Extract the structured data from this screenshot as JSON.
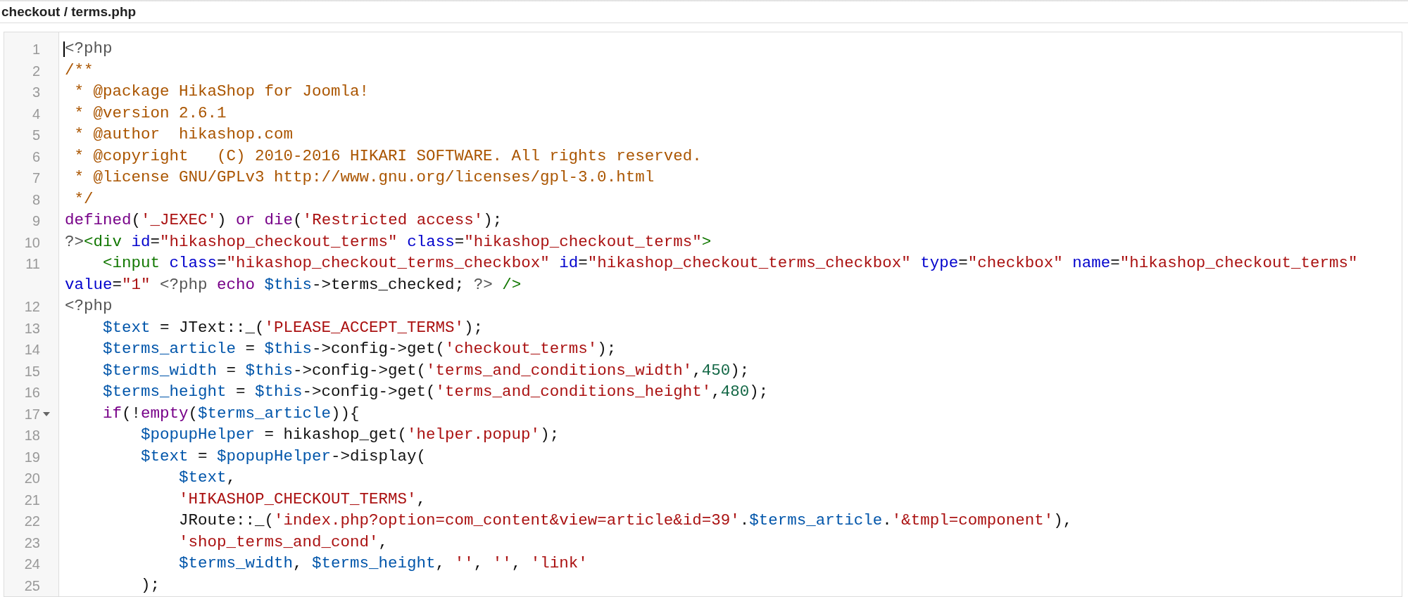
{
  "header": {
    "title": "checkout / terms.php"
  },
  "editor": {
    "lines": [
      {
        "number": "1",
        "tokens": [
          {
            "kind": "meta",
            "text": "<?php"
          }
        ]
      },
      {
        "number": "2",
        "tokens": [
          {
            "kind": "comment",
            "text": "/**"
          }
        ]
      },
      {
        "number": "3",
        "tokens": [
          {
            "kind": "comment",
            "text": " * @package HikaShop for Joomla!"
          }
        ]
      },
      {
        "number": "4",
        "tokens": [
          {
            "kind": "comment",
            "text": " * @version 2.6.1"
          }
        ]
      },
      {
        "number": "5",
        "tokens": [
          {
            "kind": "comment",
            "text": " * @author  hikashop.com"
          }
        ]
      },
      {
        "number": "6",
        "tokens": [
          {
            "kind": "comment",
            "text": " * @copyright   (C) 2010-2016 HIKARI SOFTWARE. All rights reserved."
          }
        ]
      },
      {
        "number": "7",
        "tokens": [
          {
            "kind": "comment",
            "text": " * @license GNU/GPLv3 http://www.gnu.org/licenses/gpl-3.0.html"
          }
        ]
      },
      {
        "number": "8",
        "tokens": [
          {
            "kind": "comment",
            "text": " */"
          }
        ]
      },
      {
        "number": "9",
        "tokens": [
          {
            "kind": "keyword",
            "text": "defined"
          },
          {
            "kind": "plain",
            "text": "("
          },
          {
            "kind": "string",
            "text": "'_JEXEC'"
          },
          {
            "kind": "plain",
            "text": ") "
          },
          {
            "kind": "keyword",
            "text": "or"
          },
          {
            "kind": "keyword",
            "text": " die"
          },
          {
            "kind": "plain",
            "text": "("
          },
          {
            "kind": "string",
            "text": "'Restricted access'"
          },
          {
            "kind": "plain",
            "text": ");"
          }
        ]
      },
      {
        "number": "10",
        "tokens": [
          {
            "kind": "meta",
            "text": "?>"
          },
          {
            "kind": "tag",
            "text": "<div"
          },
          {
            "kind": "attr",
            "text": " id"
          },
          {
            "kind": "plain",
            "text": "="
          },
          {
            "kind": "string",
            "text": "\"hikashop_checkout_terms\""
          },
          {
            "kind": "attr",
            "text": " class"
          },
          {
            "kind": "plain",
            "text": "="
          },
          {
            "kind": "string",
            "text": "\"hikashop_checkout_terms\""
          },
          {
            "kind": "tag",
            "text": ">"
          }
        ]
      },
      {
        "number": "11",
        "tokens": [
          {
            "kind": "tag",
            "text": "    <input"
          },
          {
            "kind": "attr",
            "text": " class"
          },
          {
            "kind": "plain",
            "text": "="
          },
          {
            "kind": "string",
            "text": "\"hikashop_checkout_terms_checkbox\""
          },
          {
            "kind": "attr",
            "text": " id"
          },
          {
            "kind": "plain",
            "text": "="
          },
          {
            "kind": "string",
            "text": "\"hikashop_checkout_terms_checkbox\""
          },
          {
            "kind": "attr",
            "text": " type"
          },
          {
            "kind": "plain",
            "text": "="
          },
          {
            "kind": "string",
            "text": "\"checkbox\""
          },
          {
            "kind": "attr",
            "text": " name"
          },
          {
            "kind": "plain",
            "text": "="
          },
          {
            "kind": "string",
            "text": "\"hikashop_checkout_terms\""
          }
        ],
        "continuation": [
          {
            "kind": "attr",
            "text": "value"
          },
          {
            "kind": "plain",
            "text": "="
          },
          {
            "kind": "string",
            "text": "\"1\""
          },
          {
            "kind": "meta",
            "text": " <?php"
          },
          {
            "kind": "keyword",
            "text": " echo"
          },
          {
            "kind": "variable",
            "text": " $this"
          },
          {
            "kind": "plain",
            "text": "->terms_checked; "
          },
          {
            "kind": "meta",
            "text": "?>"
          },
          {
            "kind": "tag",
            "text": " />"
          }
        ]
      },
      {
        "number": "12",
        "tokens": [
          {
            "kind": "meta",
            "text": "<?php"
          }
        ]
      },
      {
        "number": "13",
        "tokens": [
          {
            "kind": "variable",
            "text": "    $text"
          },
          {
            "kind": "plain",
            "text": " = JText::_("
          },
          {
            "kind": "string",
            "text": "'PLEASE_ACCEPT_TERMS'"
          },
          {
            "kind": "plain",
            "text": ");"
          }
        ]
      },
      {
        "number": "14",
        "tokens": [
          {
            "kind": "variable",
            "text": "    $terms_article"
          },
          {
            "kind": "plain",
            "text": " = "
          },
          {
            "kind": "variable",
            "text": "$this"
          },
          {
            "kind": "plain",
            "text": "->config->get("
          },
          {
            "kind": "string",
            "text": "'checkout_terms'"
          },
          {
            "kind": "plain",
            "text": ");"
          }
        ]
      },
      {
        "number": "15",
        "tokens": [
          {
            "kind": "variable",
            "text": "    $terms_width"
          },
          {
            "kind": "plain",
            "text": " = "
          },
          {
            "kind": "variable",
            "text": "$this"
          },
          {
            "kind": "plain",
            "text": "->config->get("
          },
          {
            "kind": "string",
            "text": "'terms_and_conditions_width'"
          },
          {
            "kind": "plain",
            "text": ","
          },
          {
            "kind": "number",
            "text": "450"
          },
          {
            "kind": "plain",
            "text": ");"
          }
        ]
      },
      {
        "number": "16",
        "tokens": [
          {
            "kind": "variable",
            "text": "    $terms_height"
          },
          {
            "kind": "plain",
            "text": " = "
          },
          {
            "kind": "variable",
            "text": "$this"
          },
          {
            "kind": "plain",
            "text": "->config->get("
          },
          {
            "kind": "string",
            "text": "'terms_and_conditions_height'"
          },
          {
            "kind": "plain",
            "text": ","
          },
          {
            "kind": "number",
            "text": "480"
          },
          {
            "kind": "plain",
            "text": ");"
          }
        ]
      },
      {
        "number": "17",
        "expanded": true,
        "tokens": [
          {
            "kind": "keyword",
            "text": "    if"
          },
          {
            "kind": "plain",
            "text": "(!"
          },
          {
            "kind": "keyword",
            "text": "empty"
          },
          {
            "kind": "plain",
            "text": "("
          },
          {
            "kind": "variable",
            "text": "$terms_article"
          },
          {
            "kind": "plain",
            "text": ")){"
          }
        ]
      },
      {
        "number": "18",
        "tokens": [
          {
            "kind": "variable",
            "text": "        $popupHelper"
          },
          {
            "kind": "plain",
            "text": " = hikashop_get("
          },
          {
            "kind": "string",
            "text": "'helper.popup'"
          },
          {
            "kind": "plain",
            "text": ");"
          }
        ]
      },
      {
        "number": "19",
        "tokens": [
          {
            "kind": "variable",
            "text": "        $text"
          },
          {
            "kind": "plain",
            "text": " = "
          },
          {
            "kind": "variable",
            "text": "$popupHelper"
          },
          {
            "kind": "plain",
            "text": "->display("
          }
        ]
      },
      {
        "number": "20",
        "tokens": [
          {
            "kind": "variable",
            "text": "            $text"
          },
          {
            "kind": "plain",
            "text": ","
          }
        ]
      },
      {
        "number": "21",
        "tokens": [
          {
            "kind": "string",
            "text": "            'HIKASHOP_CHECKOUT_TERMS'"
          },
          {
            "kind": "plain",
            "text": ","
          }
        ]
      },
      {
        "number": "22",
        "tokens": [
          {
            "kind": "plain",
            "text": "            JRoute::_("
          },
          {
            "kind": "string",
            "text": "'index.php?option=com_content&view=article&id=39'"
          },
          {
            "kind": "plain",
            "text": "."
          },
          {
            "kind": "variable",
            "text": "$terms_article"
          },
          {
            "kind": "plain",
            "text": "."
          },
          {
            "kind": "string",
            "text": "'&tmpl=component'"
          },
          {
            "kind": "plain",
            "text": "),"
          }
        ]
      },
      {
        "number": "23",
        "tokens": [
          {
            "kind": "string",
            "text": "            'shop_terms_and_cond'"
          },
          {
            "kind": "plain",
            "text": ","
          }
        ]
      },
      {
        "number": "24",
        "tokens": [
          {
            "kind": "variable",
            "text": "            $terms_width"
          },
          {
            "kind": "plain",
            "text": ", "
          },
          {
            "kind": "variable",
            "text": "$terms_height"
          },
          {
            "kind": "plain",
            "text": ", "
          },
          {
            "kind": "string",
            "text": "''"
          },
          {
            "kind": "plain",
            "text": ", "
          },
          {
            "kind": "string",
            "text": "''"
          },
          {
            "kind": "plain",
            "text": ", "
          },
          {
            "kind": "string",
            "text": "'link'"
          }
        ]
      },
      {
        "number": "25",
        "tokens": [
          {
            "kind": "plain",
            "text": "        );"
          }
        ]
      }
    ]
  }
}
